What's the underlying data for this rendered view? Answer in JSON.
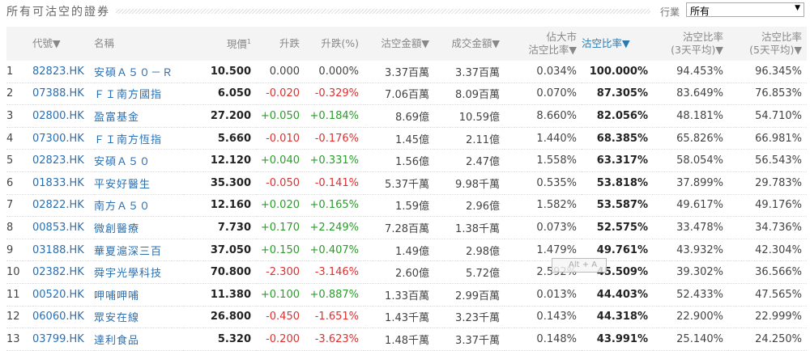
{
  "title": "所有可沽空的證券",
  "industry": {
    "label": "行業",
    "value": "所有"
  },
  "headers": {
    "code": "代號▼",
    "name": "名稱",
    "price": "現價",
    "price_sup": "1",
    "change": "升跌",
    "pct": "升跌(%)",
    "short_amt": "沽空金額▼",
    "turnover": "成交金額▼",
    "mkt_ratio_1": "佔大市",
    "mkt_ratio_2": "沽空比率▼",
    "ratio": "沽空比率▼",
    "avg3_1": "沽空比率",
    "avg3_2": "(3天平均)▼",
    "avg5_1": "沽空比率",
    "avg5_2": "(5天平均)▼"
  },
  "rows": [
    {
      "no": "1",
      "code": "82823.HK",
      "name": "安碩Ａ５０－Ｒ",
      "price": "10.500",
      "change": "0.000",
      "pct": "0.000%",
      "dir": "flat",
      "short_amt": "3.37百萬",
      "turnover": "3.37百萬",
      "mkt": "0.034%",
      "ratio": "100.000%",
      "avg3": "94.453%",
      "avg5": "96.345%"
    },
    {
      "no": "2",
      "code": "07388.HK",
      "name": "ＦＩ南方國指",
      "price": "6.050",
      "change": "-0.020",
      "pct": "-0.329%",
      "dir": "dn",
      "short_amt": "7.06百萬",
      "turnover": "8.09百萬",
      "mkt": "0.070%",
      "ratio": "87.305%",
      "avg3": "83.649%",
      "avg5": "76.853%"
    },
    {
      "no": "3",
      "code": "02800.HK",
      "name": "盈富基金",
      "price": "27.200",
      "change": "+0.050",
      "pct": "+0.184%",
      "dir": "up",
      "short_amt": "8.69億",
      "turnover": "10.59億",
      "mkt": "8.660%",
      "ratio": "82.056%",
      "avg3": "48.181%",
      "avg5": "54.710%"
    },
    {
      "no": "4",
      "code": "07300.HK",
      "name": "ＦＩ南方恆指",
      "price": "5.660",
      "change": "-0.010",
      "pct": "-0.176%",
      "dir": "dn",
      "short_amt": "1.45億",
      "turnover": "2.11億",
      "mkt": "1.440%",
      "ratio": "68.385%",
      "avg3": "65.826%",
      "avg5": "66.981%"
    },
    {
      "no": "5",
      "code": "02823.HK",
      "name": "安碩Ａ５０",
      "price": "12.120",
      "change": "+0.040",
      "pct": "+0.331%",
      "dir": "up",
      "short_amt": "1.56億",
      "turnover": "2.47億",
      "mkt": "1.558%",
      "ratio": "63.317%",
      "avg3": "58.054%",
      "avg5": "56.543%"
    },
    {
      "no": "6",
      "code": "01833.HK",
      "name": "平安好醫生",
      "price": "35.300",
      "change": "-0.050",
      "pct": "-0.141%",
      "dir": "dn",
      "short_amt": "5.37千萬",
      "turnover": "9.98千萬",
      "mkt": "0.535%",
      "ratio": "53.818%",
      "avg3": "37.899%",
      "avg5": "29.783%"
    },
    {
      "no": "7",
      "code": "02822.HK",
      "name": "南方Ａ５０",
      "price": "12.160",
      "change": "+0.020",
      "pct": "+0.165%",
      "dir": "up",
      "short_amt": "1.59億",
      "turnover": "2.96億",
      "mkt": "1.582%",
      "ratio": "53.587%",
      "avg3": "49.617%",
      "avg5": "49.176%"
    },
    {
      "no": "8",
      "code": "00853.HK",
      "name": "微創醫療",
      "price": "7.730",
      "change": "+0.170",
      "pct": "+2.249%",
      "dir": "up",
      "short_amt": "7.28百萬",
      "turnover": "1.38千萬",
      "mkt": "0.073%",
      "ratio": "52.575%",
      "avg3": "33.478%",
      "avg5": "34.736%"
    },
    {
      "no": "9",
      "code": "03188.HK",
      "name": "華夏滬深三百",
      "price": "37.050",
      "change": "+0.150",
      "pct": "+0.407%",
      "dir": "up",
      "short_amt": "1.49億",
      "turnover": "2.98億",
      "mkt": "1.479%",
      "ratio": "49.761%",
      "avg3": "43.932%",
      "avg5": "42.304%"
    },
    {
      "no": "10",
      "code": "02382.HK",
      "name": "舜宇光學科技",
      "price": "70.800",
      "change": "-2.300",
      "pct": "-3.146%",
      "dir": "dn",
      "short_amt": "2.60億",
      "turnover": "5.72億",
      "mkt": "2.592%",
      "ratio": "45.509%",
      "avg3": "39.302%",
      "avg5": "36.566%"
    },
    {
      "no": "11",
      "code": "00520.HK",
      "name": "呷哺呷哺",
      "price": "11.380",
      "change": "+0.100",
      "pct": "+0.887%",
      "dir": "up",
      "short_amt": "1.33百萬",
      "turnover": "2.99百萬",
      "mkt": "0.013%",
      "ratio": "44.403%",
      "avg3": "52.433%",
      "avg5": "47.565%"
    },
    {
      "no": "12",
      "code": "06060.HK",
      "name": "眾安在線",
      "price": "26.800",
      "change": "-0.450",
      "pct": "-1.651%",
      "dir": "dn",
      "short_amt": "1.43千萬",
      "turnover": "3.23千萬",
      "mkt": "0.143%",
      "ratio": "44.318%",
      "avg3": "22.900%",
      "avg5": "22.999%"
    },
    {
      "no": "13",
      "code": "03799.HK",
      "name": "達利食品",
      "price": "5.320",
      "change": "-0.200",
      "pct": "-3.623%",
      "dir": "dn",
      "short_amt": "1.48千萬",
      "turnover": "3.37千萬",
      "mkt": "0.148%",
      "ratio": "43.991%",
      "avg3": "25.140%",
      "avg5": "24.250%"
    }
  ],
  "tooltip": "Alt + A"
}
